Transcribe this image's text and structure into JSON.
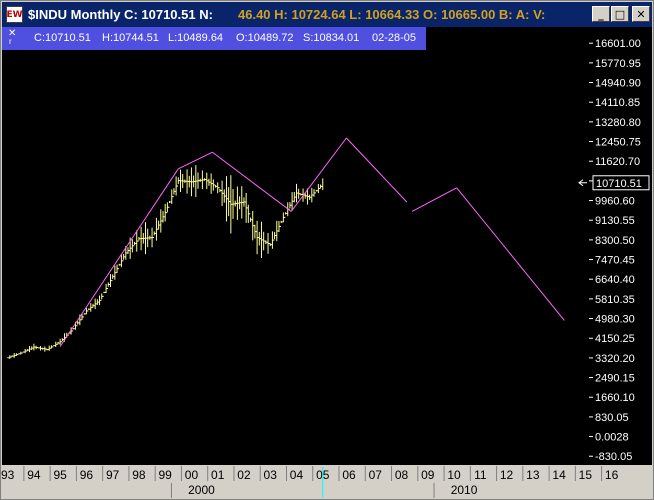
{
  "window": {
    "title_left": "$INDU Monthly C: 10710.51 N:",
    "title_right": "46.40 H: 10724.64 L: 10664.33 O: 10665.00 B: A: V:",
    "buttons": {
      "minimize": "_",
      "maximize": "□",
      "close": "✕"
    },
    "app_icon": "EW"
  },
  "info_bar": {
    "close": "✕",
    "sub": "r",
    "close_value": "C:10710.51",
    "high_value": "H:10744.51",
    "low_value": "L:10489.64",
    "open_value": "O:10489.72",
    "s_value": "S:10834.01",
    "date": "02-28-05"
  },
  "price_axis": {
    "labels": [
      "16601.00",
      "15770.95",
      "14940.90",
      "14110.85",
      "13280.80",
      "12450.75",
      "11620.70",
      "10790.65",
      "9960.60",
      "9130.55",
      "8300.50",
      "7470.45",
      "6640.40",
      "5810.35",
      "4980.30",
      "4150.25",
      "3320.20",
      "2490.15",
      "1660.10",
      "830.05",
      "0.0028",
      "-830.05"
    ],
    "current": "10710.51",
    "current_value": 10710.51
  },
  "time_axis": {
    "year_labels": [
      "93",
      "94",
      "95",
      "96",
      "97",
      "98",
      "99",
      "00",
      "01",
      "02",
      "03",
      "04",
      "05",
      "06",
      "07",
      "08",
      "09",
      "10",
      "11",
      "12",
      "13",
      "14",
      "15",
      "16"
    ],
    "decade_labels": [
      {
        "label": "2000",
        "year": 2000
      },
      {
        "label": "2010",
        "year": 2010
      }
    ]
  },
  "colors": {
    "background": "#000000",
    "bars": "#ffff99",
    "projection": "#ff66ff",
    "axis_text": "#ffffff",
    "cursor": "#00ffff"
  },
  "chart_data": {
    "type": "line",
    "symbol": "$INDU",
    "interval": "Monthly",
    "price_series_approx": [
      {
        "x": 1993.0,
        "low": 3200,
        "high": 3450
      },
      {
        "x": 1993.5,
        "low": 3400,
        "high": 3650
      },
      {
        "x": 1994.0,
        "low": 3600,
        "high": 3950
      },
      {
        "x": 1994.5,
        "low": 3550,
        "high": 3800
      },
      {
        "x": 1995.0,
        "low": 3800,
        "high": 4200
      },
      {
        "x": 1995.5,
        "low": 4300,
        "high": 4800
      },
      {
        "x": 1996.0,
        "low": 5000,
        "high": 5600
      },
      {
        "x": 1996.5,
        "low": 5500,
        "high": 6000
      },
      {
        "x": 1997.0,
        "low": 6400,
        "high": 7100
      },
      {
        "x": 1997.5,
        "low": 7300,
        "high": 8200
      },
      {
        "x": 1998.0,
        "low": 7600,
        "high": 9100
      },
      {
        "x": 1998.5,
        "low": 7500,
        "high": 9300
      },
      {
        "x": 1999.0,
        "low": 9000,
        "high": 9900
      },
      {
        "x": 1999.5,
        "low": 10300,
        "high": 11300
      },
      {
        "x": 2000.0,
        "low": 9800,
        "high": 11700
      },
      {
        "x": 2000.5,
        "low": 10300,
        "high": 11400
      },
      {
        "x": 2001.0,
        "low": 10000,
        "high": 11000
      },
      {
        "x": 2001.5,
        "low": 8300,
        "high": 11300
      },
      {
        "x": 2002.0,
        "low": 9200,
        "high": 10600
      },
      {
        "x": 2002.5,
        "low": 7300,
        "high": 9500
      },
      {
        "x": 2003.0,
        "low": 7500,
        "high": 8700
      },
      {
        "x": 2003.5,
        "low": 8800,
        "high": 9700
      },
      {
        "x": 2004.0,
        "low": 9800,
        "high": 10750
      },
      {
        "x": 2004.5,
        "low": 9700,
        "high": 10500
      },
      {
        "x": 2005.0,
        "low": 10400,
        "high": 10900
      }
    ],
    "projection_lines": [
      [
        [
          1995.0,
          3800
        ],
        [
          1999.5,
          11300
        ]
      ],
      [
        [
          1999.5,
          11300
        ],
        [
          2000.8,
          12000
        ]
      ],
      [
        [
          2000.8,
          12000
        ],
        [
          2003.8,
          9500
        ]
      ],
      [
        [
          2003.8,
          9500
        ],
        [
          2005.9,
          12600
        ]
      ],
      [
        [
          2005.9,
          12600
        ],
        [
          2008.2,
          9900
        ]
      ],
      [
        [
          2008.4,
          9500
        ],
        [
          2010.1,
          10500
        ]
      ],
      [
        [
          2010.1,
          10500
        ],
        [
          2014.2,
          4900
        ]
      ]
    ],
    "xlim": [
      1992.9,
      2017.5
    ],
    "ylim": [
      -1200,
      17200
    ]
  }
}
